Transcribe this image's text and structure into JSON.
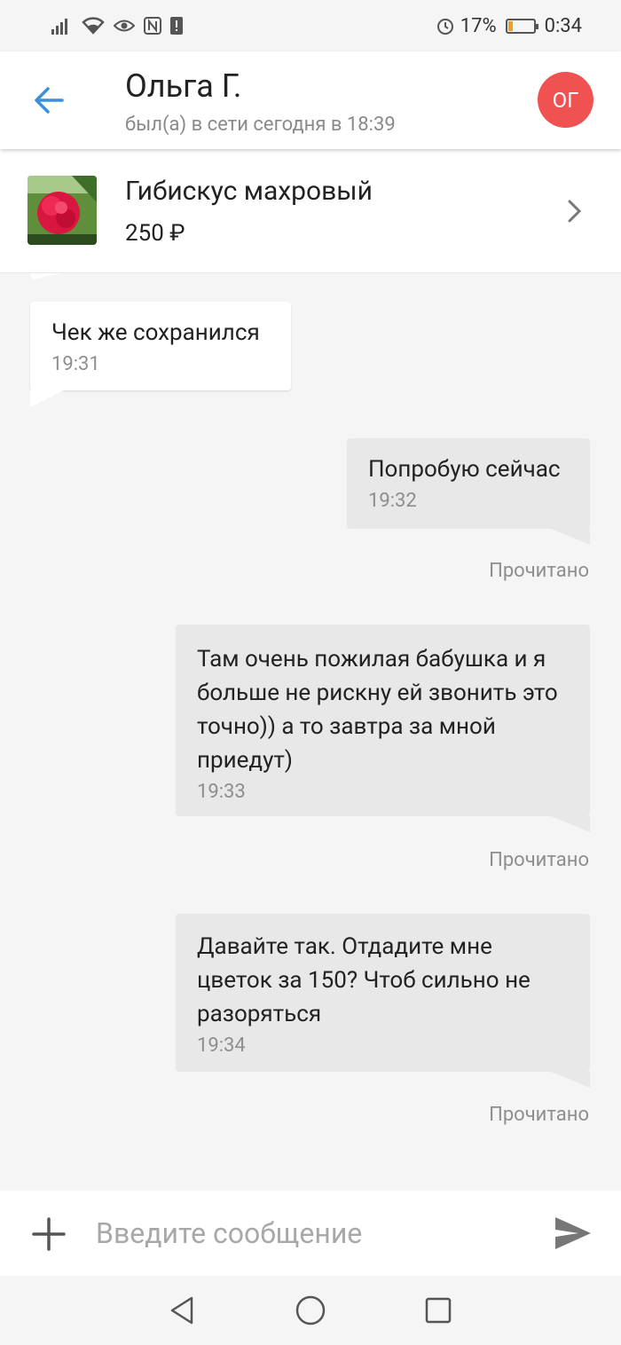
{
  "status_bar": {
    "battery_percent": "17%",
    "time": "0:34",
    "battery_level": 0.17,
    "icons": [
      "signal-icon",
      "wifi-icon",
      "eye-icon",
      "nfc-icon",
      "alert-icon",
      "alarm-icon",
      "battery-icon"
    ]
  },
  "header": {
    "name": "Ольга Г.",
    "status": "был(а) в сети сегодня в 18:39",
    "avatar_initials": "ОГ",
    "avatar_color": "#f05252",
    "accent_color": "#3d8fd8"
  },
  "product": {
    "title": "Гибискус махровый",
    "price": "250 ₽"
  },
  "messages": [
    {
      "direction": "in",
      "text": "Чек же сохранился",
      "time": "19:31"
    },
    {
      "direction": "out",
      "text": "Попробую сейчас",
      "time": "19:32",
      "read": "Прочитано"
    },
    {
      "direction": "out",
      "text": "Там очень пожилая бабушка и я больше не рискну ей звонить это точно)) а то завтра за мной приедут)",
      "time": "19:33",
      "read": "Прочитано"
    },
    {
      "direction": "out",
      "text": "Давайте так. Отдадите мне цветок за 150? Чтоб сильно не разоряться",
      "time": "19:34",
      "read": "Прочитано"
    }
  ],
  "composer": {
    "placeholder": "Введите сообщение"
  }
}
